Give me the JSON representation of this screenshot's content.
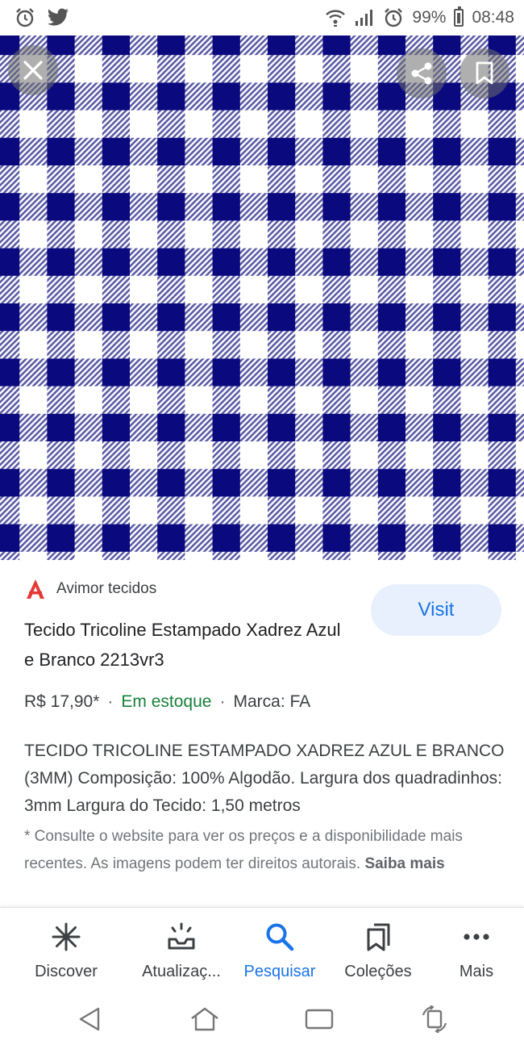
{
  "status_bar": {
    "battery": "99%",
    "time": "08:48"
  },
  "hero": {
    "pattern_colors": {
      "navy": "#0a0a7e",
      "stripe": "#6a6aa8",
      "white": "#ffffff"
    }
  },
  "result": {
    "source_name": "Avimor tecidos",
    "visit_label": "Visit",
    "title": "Tecido Tricoline Estampado Xadrez Azul e Branco 2213vr3",
    "price": "R$ 17,90*",
    "separator": "·",
    "stock": "Em estoque",
    "brand": "Marca: FA",
    "description": "TECIDO TRICOLINE ESTAMPADO XADREZ AZUL E BRANCO (3MM) Composição: 100% Algodão. Largura dos quadradinhos: 3mm Largura do Tecido: 1,50 metros",
    "disclaimer": "* Consulte o website para ver os preços e a disponibilidade mais recentes. As imagens podem ter direitos autorais.",
    "learn_more": "Saiba mais"
  },
  "bottom_nav": {
    "items": [
      {
        "label": "Discover",
        "icon": "asterisk-icon"
      },
      {
        "label": "Atualizaç...",
        "icon": "updates-tray-icon"
      },
      {
        "label": "Pesquisar",
        "icon": "search-icon"
      },
      {
        "label": "Coleções",
        "icon": "collections-icon"
      },
      {
        "label": "Mais",
        "icon": "more-dots-icon"
      }
    ],
    "active_index": 2
  },
  "colors": {
    "accent": "#1a73e8",
    "stock_green": "#188038",
    "brand_red": "#e53935"
  }
}
